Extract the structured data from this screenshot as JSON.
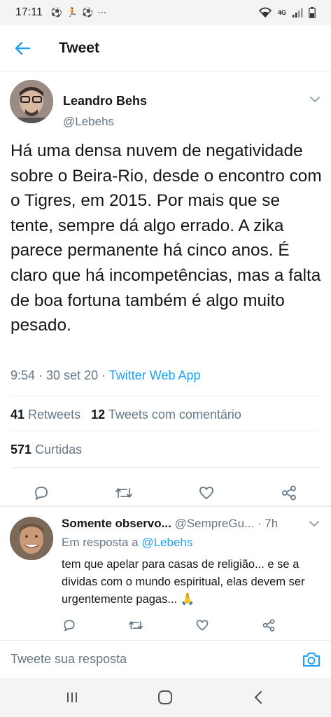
{
  "status_bar": {
    "time": "17:11",
    "glyphs": [
      "⚽",
      "🏃",
      "⚽",
      "⋯"
    ],
    "network": "4G"
  },
  "header": {
    "title": "Tweet"
  },
  "tweet": {
    "author_name": "Leandro Behs",
    "author_handle": "@Lebehs",
    "text": "Há uma densa nuvem de negatividade sobre o Beira-Rio, desde o encontro com o Tigres, em 2015. Por mais que se tente, sempre dá algo errado. A zika parece permanente há cinco anos. É claro que há incompetências, mas a falta de boa fortuna também é algo muito pesado.",
    "time": "9:54 · 30 set 20 · ",
    "source": "Twitter Web App",
    "retweets_count": "41",
    "retweets_label": "Retweets",
    "quotes_count": "12",
    "quotes_label": "Tweets com comentário",
    "likes_count": "571",
    "likes_label": "Curtidas"
  },
  "reply": {
    "name": "Somente observo...",
    "handle": "@SempreGu...",
    "age": " · 7h",
    "in_reply_prefix": "Em resposta a ",
    "in_reply_mention": "@Lebehs",
    "text": "tem que apelar para casas de religião... e se a dividas com o mundo espiritual, elas devem ser urgentemente pagas... 🙏"
  },
  "composer": {
    "placeholder": "Tweete sua resposta"
  },
  "colors": {
    "accent": "#1da1f2",
    "secondary_text": "#657786",
    "divider": "#e6ecf0"
  }
}
